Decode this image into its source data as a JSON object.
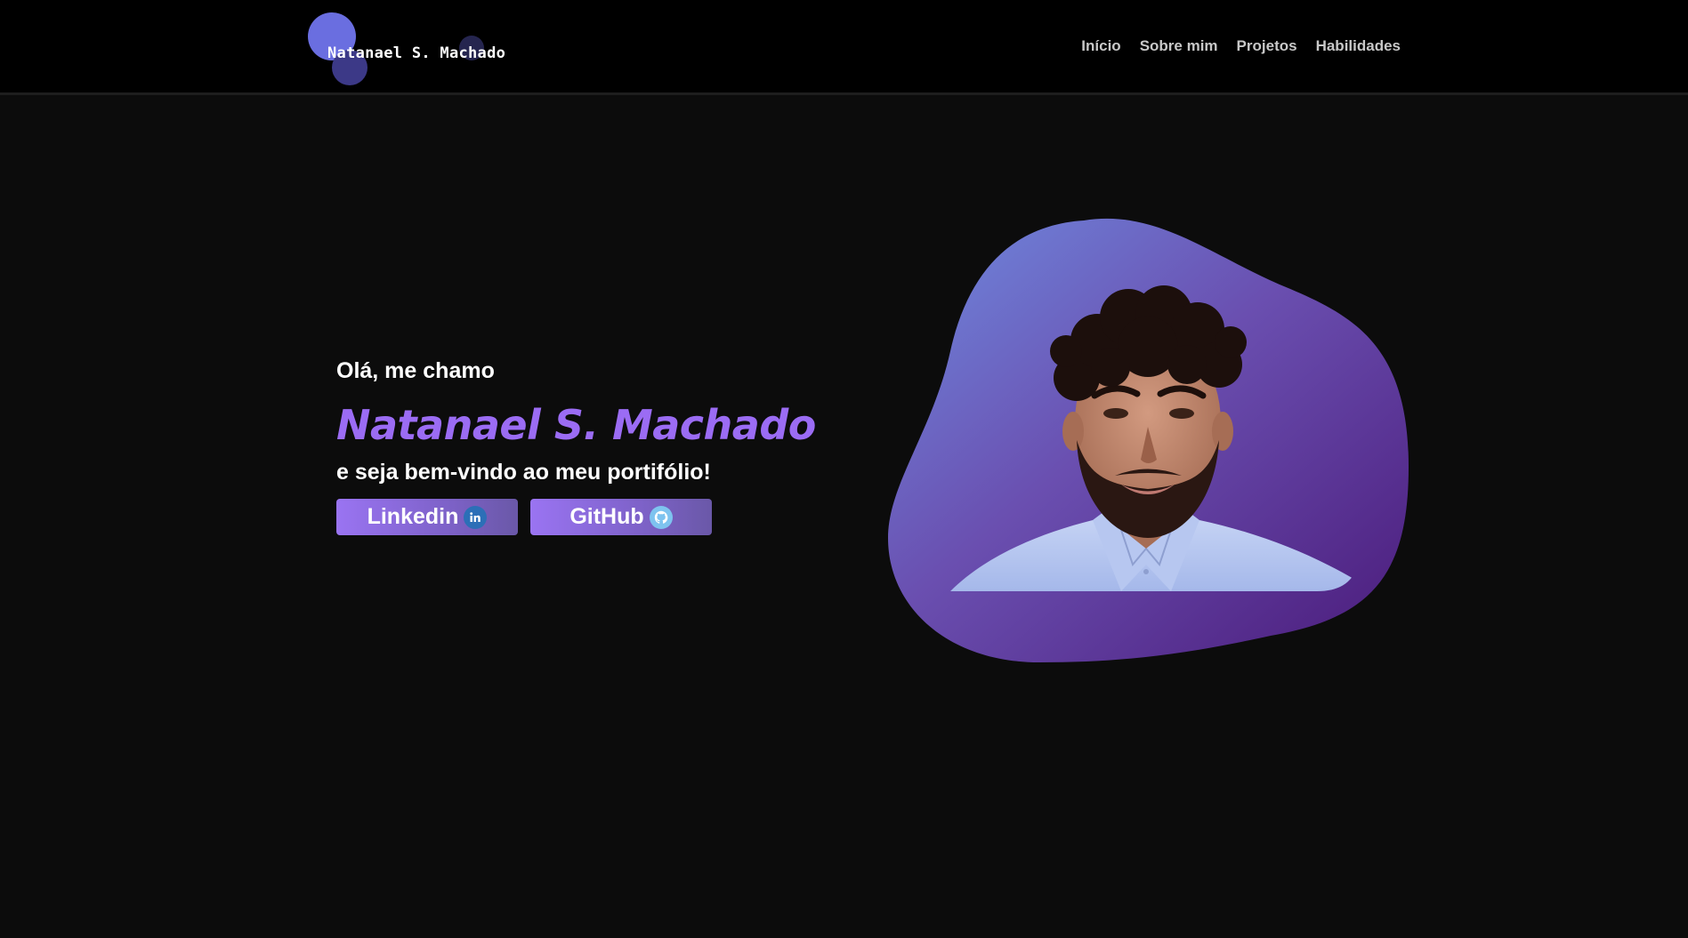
{
  "brand": {
    "logo_text": "Natanael S. Machado"
  },
  "nav": {
    "items": [
      {
        "label": "Início"
      },
      {
        "label": "Sobre mim"
      },
      {
        "label": "Projetos"
      },
      {
        "label": "Habilidades"
      }
    ]
  },
  "hero": {
    "greeting": "Olá, me chamo",
    "name": "Natanael S. Machado",
    "welcome": "e seja bem-vindo ao meu portifólio!",
    "buttons": {
      "linkedin_label": "Linkedin",
      "github_label": "GitHub"
    }
  },
  "icons": {
    "linkedin": "linkedin-icon",
    "github": "github-icon"
  },
  "colors": {
    "accent": "#9b6cf4",
    "background": "#0c0c0c",
    "header": "#000000",
    "blob_gradient_start": "#6f8be0",
    "blob_gradient_end": "#4a1a7a"
  }
}
